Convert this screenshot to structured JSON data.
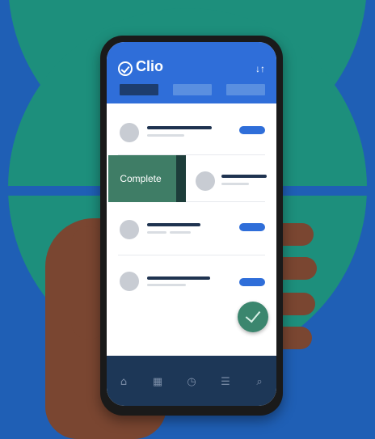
{
  "app": {
    "name": "Clio"
  },
  "header": {
    "logo_icon": "check-circle-icon",
    "sort_icon": "sort-icon",
    "sort_glyph": "↓↑",
    "tabs_count": 3
  },
  "actions": {
    "complete_label": "Complete"
  },
  "navigation": {
    "items": [
      {
        "icon": "home-icon",
        "glyph": "⌂"
      },
      {
        "icon": "calendar-icon",
        "glyph": "▦"
      },
      {
        "icon": "clock-icon",
        "glyph": "◷"
      },
      {
        "icon": "list-icon",
        "glyph": "☰"
      },
      {
        "icon": "search-icon",
        "glyph": "⌕"
      }
    ]
  },
  "colors": {
    "background": "#1f5fb5",
    "teal": "#1d8f7c",
    "header": "#2f6ed9",
    "navbar": "#1d3757",
    "complete": "#3f7d66"
  }
}
